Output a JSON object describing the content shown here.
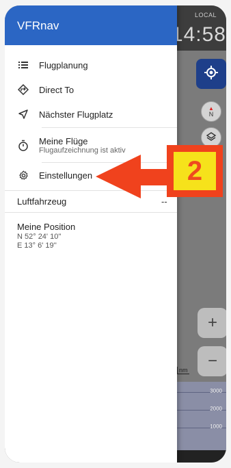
{
  "map": {
    "local_label": "LOCAL",
    "clock": "14:58",
    "compass_label": "N",
    "zoom_in": "+",
    "zoom_out": "−",
    "scale_unit": "nm",
    "altitudes": [
      "3000",
      "2000",
      "1000"
    ],
    "airplane_value": "--"
  },
  "drawer": {
    "title": "VFRnav",
    "items": [
      {
        "label": "Flugplanung",
        "icon": "list-icon"
      },
      {
        "label": "Direct To",
        "icon": "direct-to-icon"
      },
      {
        "label": "Nächster Flugplatz",
        "icon": "navigation-arrow-icon"
      },
      {
        "label": "Meine Flüge",
        "sublabel": "Flugaufzeichnung ist aktiv",
        "icon": "stopwatch-icon"
      },
      {
        "label": "Einstellungen",
        "icon": "gear-icon"
      }
    ],
    "aircraft_label": "Luftfahrzeug",
    "position": {
      "title": "Meine Position",
      "lat": "N 52° 24' 10''",
      "lon": "E 13° 6' 19''"
    }
  },
  "annotation": {
    "number": "2",
    "arrow_color": "#f0421d",
    "badge_fill": "#f6e21b"
  }
}
